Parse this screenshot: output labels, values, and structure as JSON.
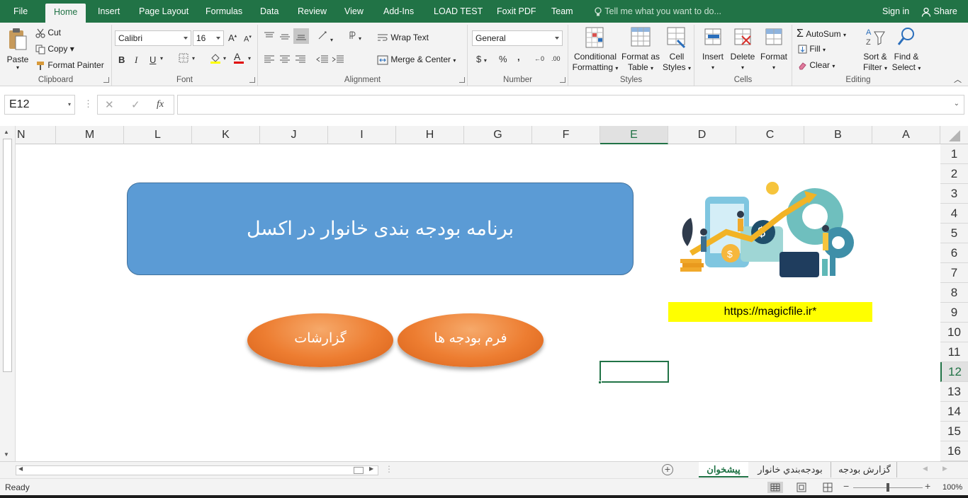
{
  "tabs": [
    "File",
    "Home",
    "Insert",
    "Page Layout",
    "Formulas",
    "Data",
    "Review",
    "View",
    "Add-Ins",
    "LOAD TEST",
    "Foxit PDF",
    "Team"
  ],
  "tell_me": "Tell me what you want to do...",
  "signin": "Sign in",
  "share": "Share",
  "clipboard": {
    "paste": "Paste",
    "cut": "Cut",
    "copy": "Copy",
    "format_painter": "Format Painter",
    "label": "Clipboard"
  },
  "font": {
    "name": "Calibri",
    "size": "16",
    "bold": "B",
    "italic": "I",
    "underline": "U",
    "label": "Font"
  },
  "alignment": {
    "wrap": "Wrap Text",
    "merge": "Merge & Center",
    "label": "Alignment"
  },
  "number": {
    "format": "General",
    "currency": "$",
    "percent": "%",
    "comma": ",",
    "inc": "←0 .00",
    "dec": ".00 →0",
    "label": "Number"
  },
  "styles": {
    "conditional": "Conditional",
    "conditional2": "Formatting",
    "format_as": "Format as",
    "format_as2": "Table",
    "cell": "Cell",
    "cell2": "Styles",
    "label": "Styles"
  },
  "cells": {
    "insert": "Insert",
    "delete": "Delete",
    "format": "Format",
    "label": "Cells"
  },
  "editing": {
    "autosum": "AutoSum",
    "fill": "Fill",
    "clear": "Clear",
    "sort": "Sort &",
    "sort2": "Filter",
    "find": "Find &",
    "find2": "Select",
    "label": "Editing"
  },
  "namebox": "E12",
  "fx": "fx",
  "columns": [
    "N",
    "M",
    "L",
    "K",
    "J",
    "I",
    "H",
    "G",
    "F",
    "E",
    "D",
    "C",
    "B",
    "A"
  ],
  "rows": [
    "1",
    "2",
    "3",
    "4",
    "5",
    "6",
    "7",
    "8",
    "9",
    "10",
    "11",
    "12",
    "13",
    "14",
    "15",
    "16"
  ],
  "title_banner": "برنامه بودجه بندی خانوار در اکسل",
  "buttons": {
    "reports": "گزارشات",
    "budget_form": "فرم بودجه ها"
  },
  "url": "https://magicfile.ir*",
  "sheets": [
    "پیشخوان",
    "بودجه‌بندي خانوار",
    "گزارش بودجه"
  ],
  "status": {
    "ready": "Ready",
    "zoom": "100%"
  },
  "colors": {
    "excel_green": "#217346",
    "banner": "#5b9bd5",
    "orange": "#ed7d31",
    "url_bg": "#ffff00"
  }
}
